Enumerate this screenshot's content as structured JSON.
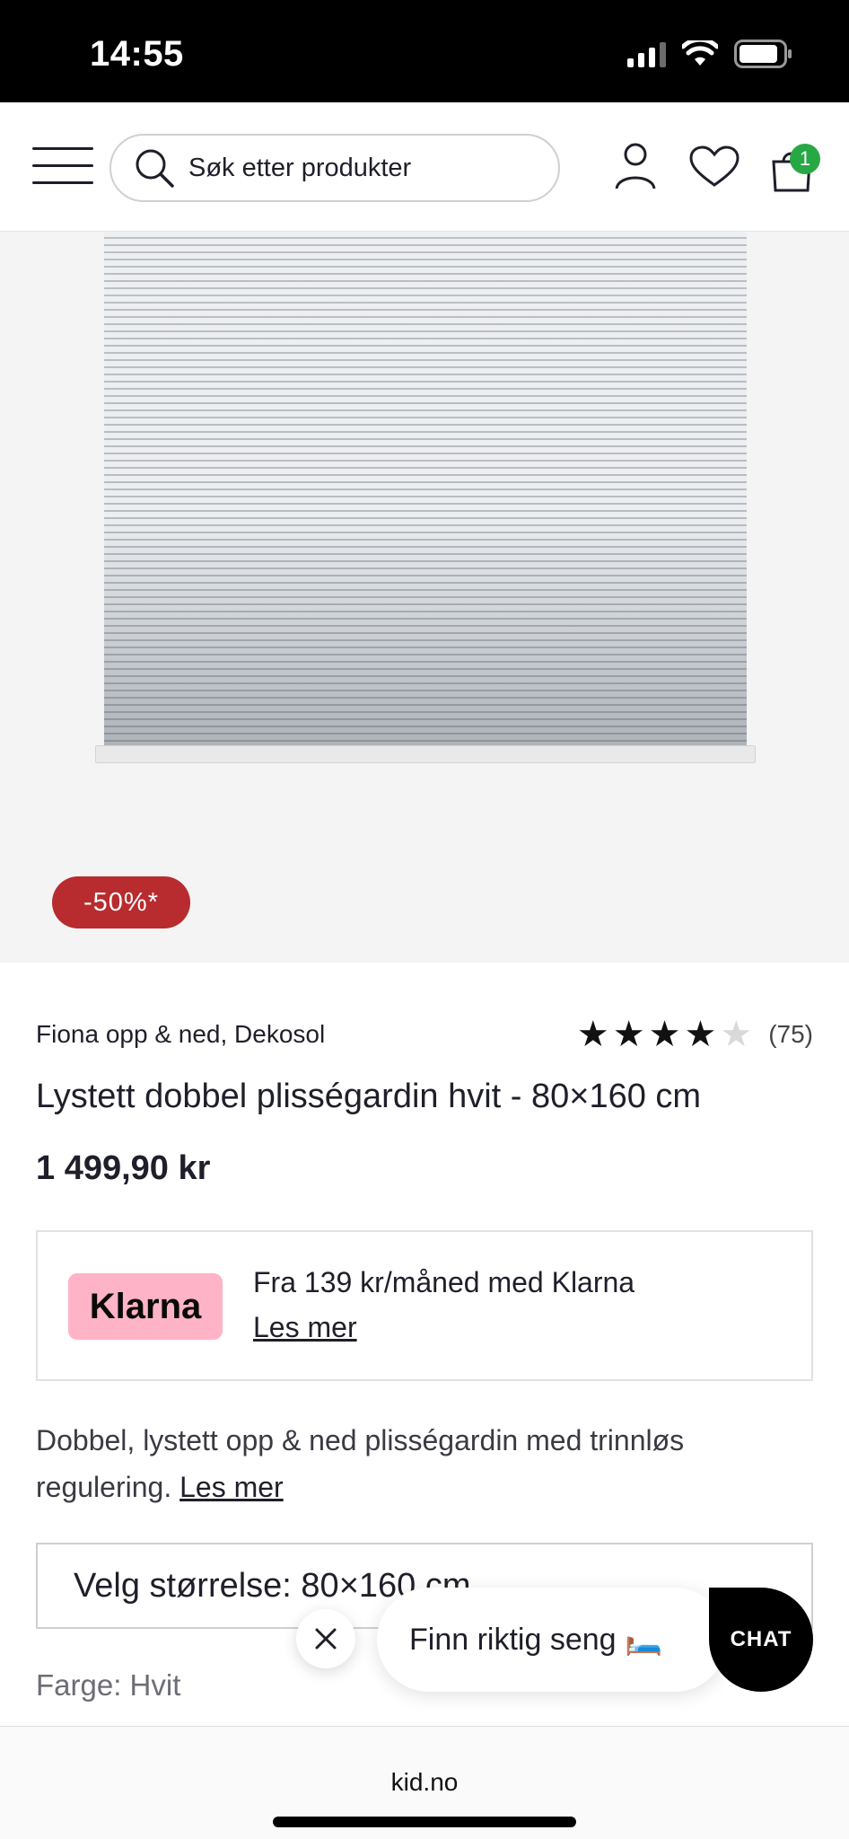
{
  "status_bar": {
    "time": "14:55"
  },
  "header": {
    "search_placeholder": "Søk etter produkter",
    "cart_count": "1"
  },
  "product": {
    "discount_badge": "-50%*",
    "brand": "Fiona opp & ned, Dekosol",
    "rating": {
      "stars": 4,
      "max": 5,
      "count": "(75)"
    },
    "title": "Lystett dobbel plisségardin hvit - 80×160 cm",
    "price": "1 499,90 kr",
    "description": "Dobbel, lystett opp & ned plisségardin med trinnløs regulering.",
    "description_link": "Les mer",
    "size_select_label": "Velg størrelse: 80×160 cm",
    "color_label": "Farge:",
    "color_value": "Hvit"
  },
  "klarna": {
    "logo_text": "Klarna",
    "text": "Fra 139 kr/måned med Klarna",
    "link": "Les mer",
    "brand_color": "#ffb3c7"
  },
  "widgets": {
    "finn_text": "Finn riktig seng 🛏️",
    "chat_label": "CHAT"
  },
  "browser": {
    "url": "kid.no"
  },
  "colors": {
    "discount": "#b82b2e",
    "cart_badge": "#28a745"
  }
}
